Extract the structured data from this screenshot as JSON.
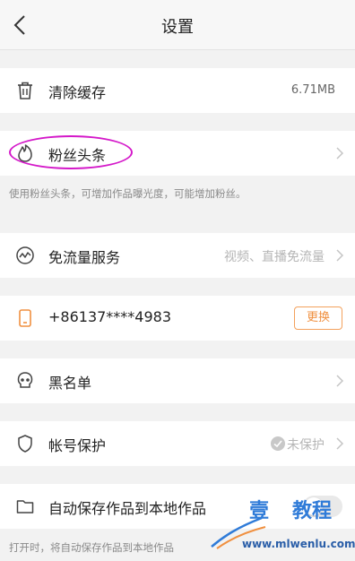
{
  "header": {
    "title": "设置"
  },
  "clear_cache": {
    "label": "清除缓存",
    "size": "6.71MB"
  },
  "fans_headline": {
    "label": "粉丝头条",
    "note": "使用粉丝头条，可增加作品曝光度，可能增加粉丝。"
  },
  "free_traffic": {
    "label": "免流量服务",
    "value": "视频、直播免流量"
  },
  "phone": {
    "number": "+86137****4983",
    "change_label": "更换"
  },
  "blacklist": {
    "label": "黑名单"
  },
  "account_protection": {
    "label": "帐号保护",
    "status": "未保护"
  },
  "auto_save": {
    "label": "自动保存作品到本地作品",
    "note": "打开时，将自动保存作品到本地作品"
  },
  "watermark": {
    "char1": "壹",
    "char2": "教程",
    "url": "www.mlwenlu.com"
  },
  "colors": {
    "accent": "#f09040",
    "annotation": "#d418c9",
    "watermark": "#2f7bd8"
  }
}
